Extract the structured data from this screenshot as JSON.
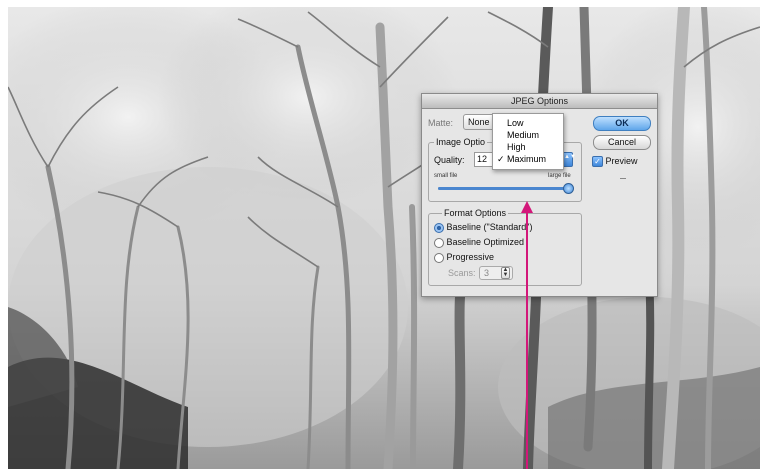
{
  "dialog": {
    "title": "JPEG Options",
    "buttons": {
      "ok": "OK",
      "cancel": "Cancel"
    },
    "preview": {
      "label": "Preview",
      "checked": true
    },
    "matte": {
      "label": "Matte:",
      "value": "None"
    },
    "image_options": {
      "legend": "Image Optio",
      "quality_label": "Quality:",
      "quality_value": "12",
      "small_file": "small file",
      "large_file": "large file",
      "slider_level": 1.0
    },
    "format_options": {
      "legend": "Format Options",
      "options": [
        "Baseline (\"Standard\")",
        "Baseline Optimized",
        "Progressive"
      ],
      "selected_index": 0,
      "scans_label": "Scans:",
      "scans_value": "3"
    }
  },
  "quality_menu": {
    "items": [
      "Low",
      "Medium",
      "High",
      "Maximum"
    ],
    "checked_index": 3,
    "check_glyph": "✓"
  },
  "colors": {
    "annotation_arrow": "#d3177a",
    "default_button": "#5fa6ea"
  }
}
